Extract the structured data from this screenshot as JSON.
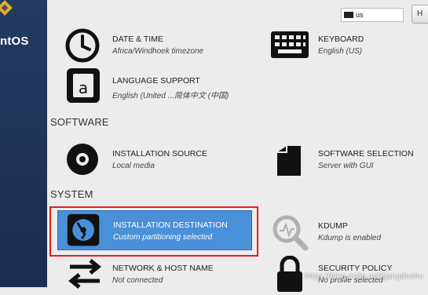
{
  "sidebar": {
    "brand_fragment": "ntOS"
  },
  "header": {
    "keyboard_indicator": "us",
    "help_button": "H"
  },
  "sections": {
    "localization": {
      "date_time": {
        "title": "DATE & TIME",
        "status": "Africa/Windhoek timezone"
      },
      "keyboard": {
        "title": "KEYBOARD",
        "status": "English (US)"
      },
      "language_support": {
        "title": "LANGUAGE SUPPORT",
        "status": "English (United ...简体中文 (中国)"
      }
    },
    "software": {
      "header": "SOFTWARE",
      "installation_source": {
        "title": "INSTALLATION SOURCE",
        "status": "Local media"
      },
      "software_selection": {
        "title": "SOFTWARE SELECTION",
        "status": "Server with GUI"
      }
    },
    "system": {
      "header": "SYSTEM",
      "installation_destination": {
        "title": "INSTALLATION DESTINATION",
        "status": "Custom partitioning selected"
      },
      "kdump": {
        "title": "KDUMP",
        "status": "Kdump is enabled"
      },
      "network_host": {
        "title": "NETWORK & HOST NAME",
        "status": "Not connected"
      },
      "security_policy": {
        "title": "SECURITY POLICY",
        "status": "No profile selected"
      }
    }
  },
  "watermark": "https://blog.csdn.net/gangdeshu",
  "colors": {
    "sidebar": "#233a61",
    "selection": "#4a90d9",
    "highlight_outline": "#e02020",
    "background": "#ececec"
  }
}
